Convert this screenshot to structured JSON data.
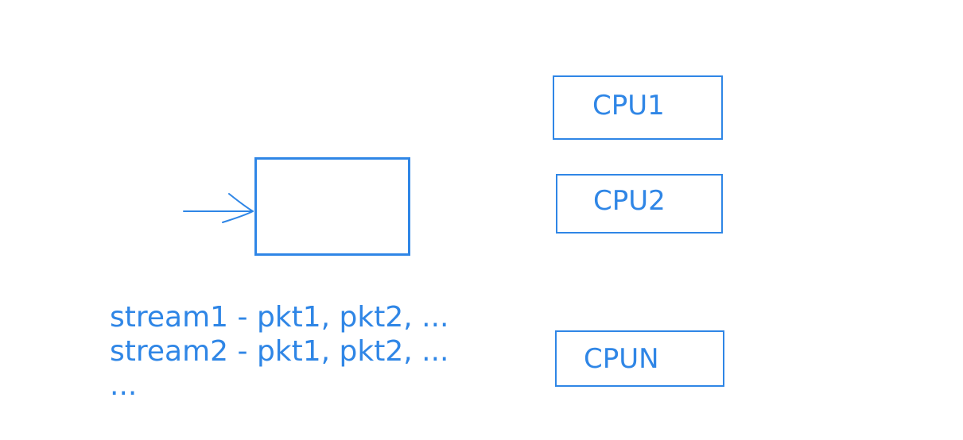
{
  "diagram": {
    "queue_box": {
      "label": ""
    },
    "cpus": [
      {
        "label": "CPU1"
      },
      {
        "label": "CPU2"
      },
      {
        "label": "CPUN"
      }
    ],
    "streams": [
      {
        "text": "stream1 - pkt1, pkt2, ..."
      },
      {
        "text": "stream2 - pkt1, pkt2, ..."
      },
      {
        "text": "..."
      }
    ],
    "colors": {
      "stroke": "#2f86e6",
      "text": "#2f86e6"
    },
    "icons": {
      "input_arrow": "arrow-right-icon"
    }
  }
}
